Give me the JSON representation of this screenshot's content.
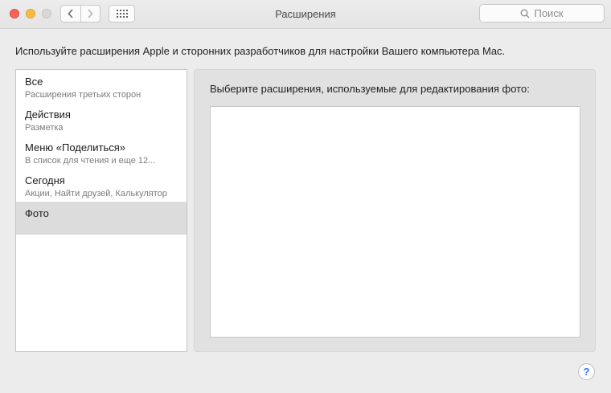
{
  "window": {
    "title": "Расширения"
  },
  "toolbar": {
    "back_icon": "chevron-left-icon",
    "forward_icon": "chevron-right-icon",
    "show_all_icon": "grid-icon",
    "search_placeholder": "Поиск"
  },
  "intro_text": "Используйте расширения Apple и сторонних разработчиков для настройки Вашего компьютера Mac.",
  "sidebar": {
    "items": [
      {
        "title": "Все",
        "subtitle": "Расширения третьих сторон"
      },
      {
        "title": "Действия",
        "subtitle": "Разметка"
      },
      {
        "title": "Меню «Поделиться»",
        "subtitle": "В список для чтения и еще 12..."
      },
      {
        "title": "Сегодня",
        "subtitle": "Акции, Найти друзей, Калькулятор"
      },
      {
        "title": "Фото",
        "subtitle": ""
      }
    ],
    "selected": "Фото"
  },
  "panel": {
    "label": "Выберите расширения, используемые для редактирования фото:"
  },
  "help_label": "?",
  "colors": {
    "accent": "#3478f6",
    "close": "#fc605c",
    "minimize": "#fdbc40",
    "zoom_disabled": "#d8d8d8"
  }
}
